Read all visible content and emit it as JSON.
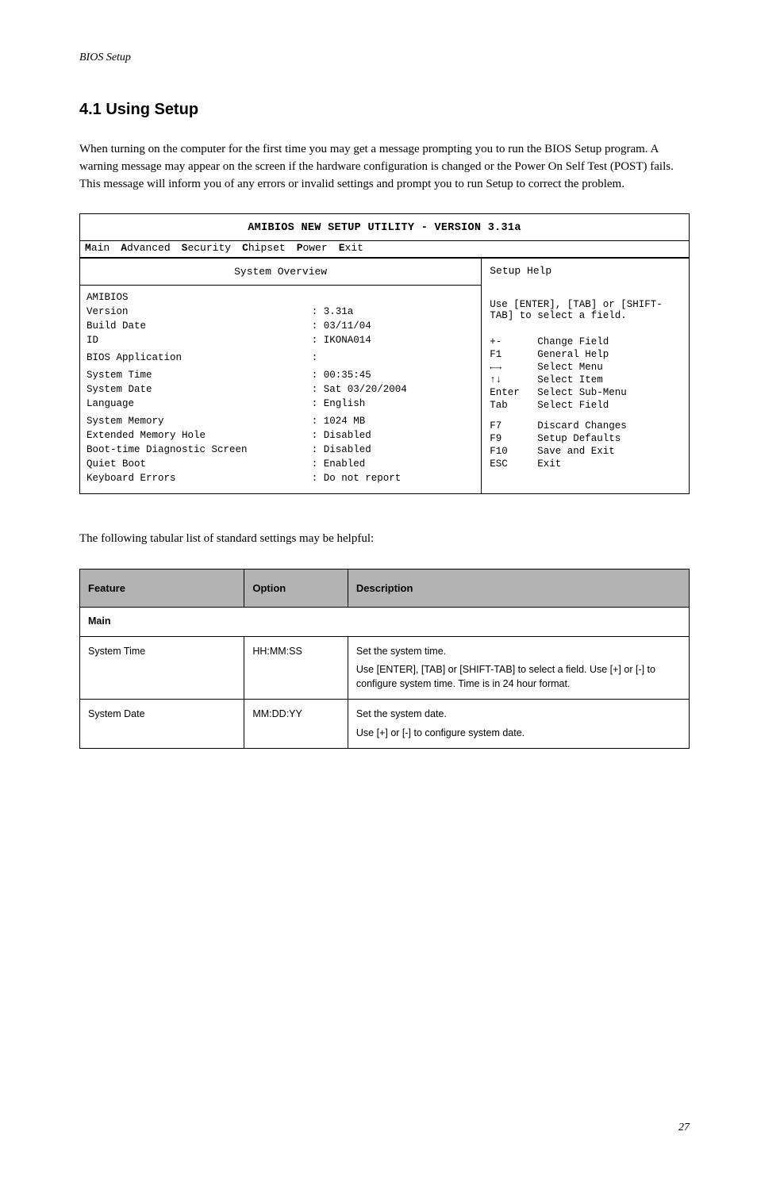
{
  "header": {
    "breadcrumb": "BIOS Setup"
  },
  "section": {
    "heading": "4.1  Using Setup",
    "intro": "When turning on the computer for the first time you may get a message prompting you to run the BIOS Setup program. A warning message may appear on the screen if the hardware configuration is changed or the Power On Self Test (POST) fails. This message will inform you of any errors or invalid settings and prompt you to run Setup to correct the problem."
  },
  "bios": {
    "title": "AMIBIOS NEW SETUP UTILITY - VERSION 3.31a",
    "menubar": [
      {
        "hotkey": "M",
        "rest": "ain"
      },
      {
        "hotkey": "A",
        "rest": "dvanced"
      },
      {
        "hotkey": "S",
        "rest": "ecurity"
      },
      {
        "hotkey": "C",
        "rest": "hipset"
      },
      {
        "hotkey": "P",
        "rest": "ower"
      },
      {
        "hotkey": "E",
        "rest": "xit"
      }
    ],
    "panel_title": "System Overview",
    "rows": [
      {
        "label": "AMIBIOS",
        "value": ""
      },
      {
        "label": "Version",
        "value": ": 3.31a"
      },
      {
        "label": "Build Date",
        "value": ": 03/11/04"
      },
      {
        "label": "ID",
        "value": ": IKONA014"
      },
      {
        "label": "",
        "value": ""
      },
      {
        "label": "BIOS Application",
        "value": ":"
      },
      {
        "label": "",
        "value": ""
      },
      {
        "label": "System Time",
        "value": ": 00:35:45"
      },
      {
        "label": "System Date",
        "value": ": Sat 03/20/2004"
      },
      {
        "label": "Language",
        "value": ": English"
      },
      {
        "label": "",
        "value": ""
      },
      {
        "label": "System Memory",
        "value": ": 1024 MB"
      },
      {
        "label": "Extended Memory Hole",
        "value": ": Disabled"
      },
      {
        "label": "Boot-time Diagnostic Screen",
        "value": ": Disabled"
      },
      {
        "label": "Quiet Boot",
        "value": ": Enabled"
      },
      {
        "label": "Keyboard Errors",
        "value": ": Do not report"
      }
    ],
    "help": {
      "title": "Setup Help",
      "text": "Use [ENTER], [TAB] or [SHIFT-TAB] to select a field.",
      "keys": [
        {
          "key": "+-",
          "desc": "Change Field"
        },
        {
          "key": "F1",
          "desc": "General Help"
        },
        {
          "key": "←→",
          "desc": "Select Menu"
        },
        {
          "key": "↑↓",
          "desc": "Select Item"
        },
        {
          "key": "Enter",
          "desc": "Select Sub-Menu"
        },
        {
          "key": "Tab",
          "desc": "Select Field"
        },
        {
          "key": "F7",
          "desc": "Discard Changes"
        },
        {
          "key": "F9",
          "desc": "Setup Defaults"
        },
        {
          "key": "F10",
          "desc": "Save and Exit"
        },
        {
          "key": "ESC",
          "desc": "Exit"
        }
      ]
    }
  },
  "table_intro": "The following tabular list of standard settings may be helpful:",
  "table": {
    "headers": [
      "Feature",
      "Option",
      "Description"
    ],
    "group": "Main",
    "rows": [
      {
        "feature": "System Time",
        "option": "HH:MM:SS",
        "desc": [
          "Set the system time.",
          "Use [ENTER], [TAB] or [SHIFT-TAB] to select a field. Use [+] or [-] to configure system time. Time is in 24 hour format."
        ]
      },
      {
        "feature": "System Date",
        "option": "MM:DD:YY",
        "desc": [
          "Set the system date.",
          "Use [+] or [-] to configure system date."
        ]
      }
    ]
  },
  "page_number": "27"
}
